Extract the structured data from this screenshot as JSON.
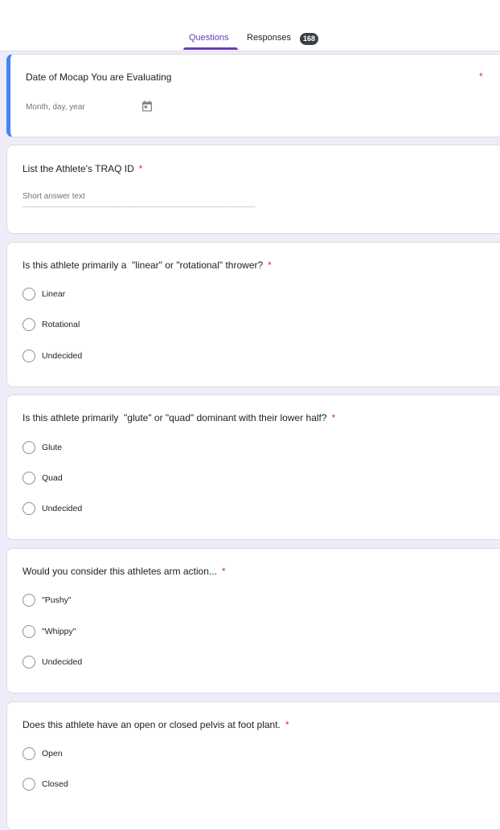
{
  "tabs": {
    "questions_label": "Questions",
    "responses_label": "Responses",
    "responses_count": "168"
  },
  "questions": [
    {
      "title": "Date of Mocap You are Evaluating",
      "required_mark": "*",
      "placeholder": "Month, day, year",
      "icon": "calendar-icon"
    },
    {
      "title": "List the Athlete's TRAQ ID",
      "required_mark": "*",
      "placeholder": "Short answer text"
    },
    {
      "title": "Is this athlete primarily a  \"linear\" or \"rotational\" thrower?",
      "required_mark": "*",
      "options": [
        "Linear",
        "Rotational",
        "Undecided"
      ]
    },
    {
      "title": "Is this athlete primarily  \"glute\" or \"quad\" dominant with their lower half?",
      "required_mark": "*",
      "options": [
        "Glute",
        "Quad",
        "Undecided"
      ]
    },
    {
      "title": "Would you consider this athletes arm action...",
      "required_mark": "*",
      "options": [
        "\"Pushy\"",
        "\"Whippy\"",
        "Undecided"
      ]
    },
    {
      "title": "Does this athlete have an open or closed pelvis at foot plant.",
      "required_mark": "*",
      "options": [
        "Open",
        "Closed"
      ]
    }
  ],
  "colors": {
    "accent": "#673ab7",
    "active_border": "#4285f4",
    "required": "#d93025",
    "background": "#f0ebf8"
  }
}
